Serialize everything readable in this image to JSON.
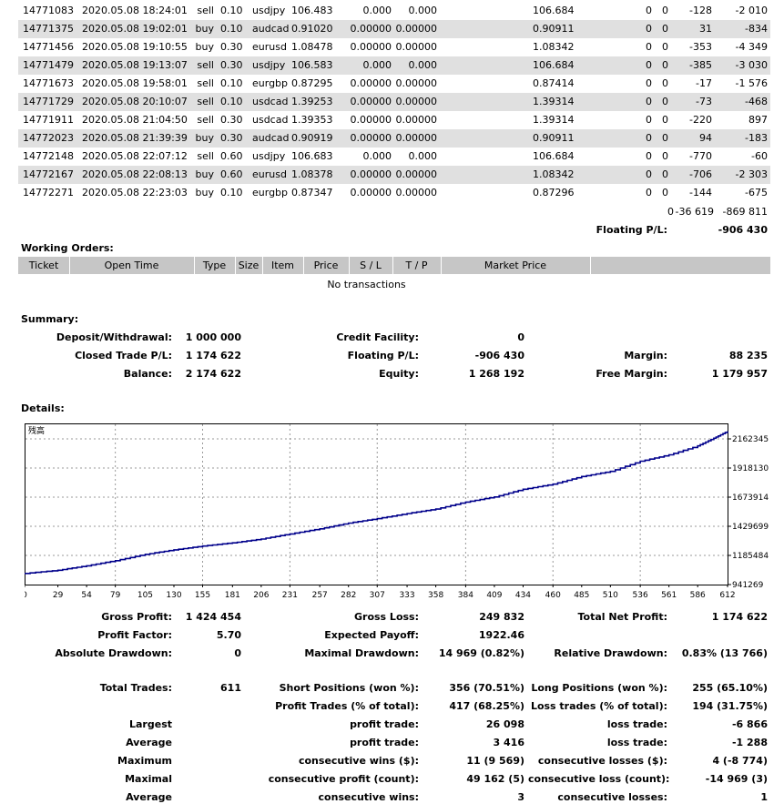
{
  "trades": [
    {
      "ticket": "14771083",
      "time": "2020.05.08 18:24:01",
      "type": "sell",
      "size": "0.10",
      "item": "usdjpy",
      "price": "106.483",
      "sl": "0.000",
      "tp": "0.000",
      "market": "106.684",
      "c1": "0",
      "c2": "0",
      "c3": "-128",
      "profit": "-2 010"
    },
    {
      "ticket": "14771375",
      "time": "2020.05.08 19:02:01",
      "type": "buy",
      "size": "0.10",
      "item": "audcad",
      "price": "0.91020",
      "sl": "0.00000",
      "tp": "0.00000",
      "market": "0.90911",
      "c1": "0",
      "c2": "0",
      "c3": "31",
      "profit": "-834"
    },
    {
      "ticket": "14771456",
      "time": "2020.05.08 19:10:55",
      "type": "buy",
      "size": "0.30",
      "item": "eurusd",
      "price": "1.08478",
      "sl": "0.00000",
      "tp": "0.00000",
      "market": "1.08342",
      "c1": "0",
      "c2": "0",
      "c3": "-353",
      "profit": "-4 349"
    },
    {
      "ticket": "14771479",
      "time": "2020.05.08 19:13:07",
      "type": "sell",
      "size": "0.30",
      "item": "usdjpy",
      "price": "106.583",
      "sl": "0.000",
      "tp": "0.000",
      "market": "106.684",
      "c1": "0",
      "c2": "0",
      "c3": "-385",
      "profit": "-3 030"
    },
    {
      "ticket": "14771673",
      "time": "2020.05.08 19:58:01",
      "type": "sell",
      "size": "0.10",
      "item": "eurgbp",
      "price": "0.87295",
      "sl": "0.00000",
      "tp": "0.00000",
      "market": "0.87414",
      "c1": "0",
      "c2": "0",
      "c3": "-17",
      "profit": "-1 576"
    },
    {
      "ticket": "14771729",
      "time": "2020.05.08 20:10:07",
      "type": "sell",
      "size": "0.10",
      "item": "usdcad",
      "price": "1.39253",
      "sl": "0.00000",
      "tp": "0.00000",
      "market": "1.39314",
      "c1": "0",
      "c2": "0",
      "c3": "-73",
      "profit": "-468"
    },
    {
      "ticket": "14771911",
      "time": "2020.05.08 21:04:50",
      "type": "sell",
      "size": "0.30",
      "item": "usdcad",
      "price": "1.39353",
      "sl": "0.00000",
      "tp": "0.00000",
      "market": "1.39314",
      "c1": "0",
      "c2": "0",
      "c3": "-220",
      "profit": "897"
    },
    {
      "ticket": "14772023",
      "time": "2020.05.08 21:39:39",
      "type": "buy",
      "size": "0.30",
      "item": "audcad",
      "price": "0.90919",
      "sl": "0.00000",
      "tp": "0.00000",
      "market": "0.90911",
      "c1": "0",
      "c2": "0",
      "c3": "94",
      "profit": "-183"
    },
    {
      "ticket": "14772148",
      "time": "2020.05.08 22:07:12",
      "type": "sell",
      "size": "0.60",
      "item": "usdjpy",
      "price": "106.683",
      "sl": "0.000",
      "tp": "0.000",
      "market": "106.684",
      "c1": "0",
      "c2": "0",
      "c3": "-770",
      "profit": "-60"
    },
    {
      "ticket": "14772167",
      "time": "2020.05.08 22:08:13",
      "type": "buy",
      "size": "0.60",
      "item": "eurusd",
      "price": "1.08378",
      "sl": "0.00000",
      "tp": "0.00000",
      "market": "1.08342",
      "c1": "0",
      "c2": "0",
      "c3": "-706",
      "profit": "-2 303"
    },
    {
      "ticket": "14772271",
      "time": "2020.05.08 22:23:03",
      "type": "buy",
      "size": "0.10",
      "item": "eurgbp",
      "price": "0.87347",
      "sl": "0.00000",
      "tp": "0.00000",
      "market": "0.87296",
      "c1": "0",
      "c2": "0",
      "c3": "-144",
      "profit": "-675"
    }
  ],
  "totals": {
    "c1": "0",
    "c2": "-36 619",
    "profit": "-869 811"
  },
  "floating": {
    "label": "Floating P/L:",
    "value": "-906 430"
  },
  "working_orders": {
    "title": "Working Orders:",
    "headers": [
      "Ticket",
      "Open Time",
      "Type",
      "Size",
      "Item",
      "Price",
      "S / L",
      "T / P",
      "Market Price"
    ],
    "empty": "No transactions"
  },
  "summary": {
    "title": "Summary:",
    "deposit_label": "Deposit/Withdrawal:",
    "deposit": "1 000 000",
    "closed_label": "Closed Trade P/L:",
    "closed": "1 174 622",
    "balance_label": "Balance:",
    "balance": "2 174 622",
    "credit_label": "Credit Facility:",
    "credit": "0",
    "floating_label": "Floating P/L:",
    "floating": "-906 430",
    "equity_label": "Equity:",
    "equity": "1 268 192",
    "margin_label": "Margin:",
    "margin": "88 235",
    "free_margin_label": "Free Margin:",
    "free_margin": "1 179 957"
  },
  "details_title": "Details:",
  "chart_data": {
    "type": "line",
    "title": "残高",
    "xlim": [
      0,
      612
    ],
    "ylim": [
      941269,
      2162345
    ],
    "x_ticks": [
      "0",
      "29",
      "54",
      "79",
      "105",
      "130",
      "155",
      "181",
      "206",
      "231",
      "257",
      "282",
      "307",
      "333",
      "358",
      "384",
      "409",
      "434",
      "460",
      "485",
      "510",
      "536",
      "561",
      "586",
      "612"
    ],
    "y_ticks": [
      "2162345",
      "1918130",
      "1673914",
      "1429699",
      "1185484",
      "941269"
    ],
    "series": [
      {
        "color": "#00008b",
        "x": [
          0,
          29,
          54,
          79,
          105,
          130,
          155,
          181,
          206,
          231,
          257,
          282,
          307,
          333,
          358,
          384,
          409,
          434,
          460,
          485,
          510,
          536,
          561,
          586,
          600,
          612
        ],
        "y": [
          1000000,
          1025000,
          1060000,
          1100000,
          1150000,
          1185000,
          1215000,
          1240000,
          1270000,
          1310000,
          1350000,
          1395000,
          1430000,
          1470000,
          1505000,
          1560000,
          1600000,
          1660000,
          1700000,
          1760000,
          1800000,
          1880000,
          1930000,
          2000000,
          2060000,
          2115000
        ]
      }
    ],
    "grid": true
  },
  "stats": {
    "gross_profit_label": "Gross Profit:",
    "gross_profit": "1 424 454",
    "gross_loss_label": "Gross Loss:",
    "gross_loss": "249 832",
    "net_profit_label": "Total Net Profit:",
    "net_profit": "1 174 622",
    "profit_factor_label": "Profit Factor:",
    "profit_factor": "5.70",
    "expected_payoff_label": "Expected Payoff:",
    "expected_payoff": "1922.46",
    "abs_dd_label": "Absolute Drawdown:",
    "abs_dd": "0",
    "max_dd_label": "Maximal Drawdown:",
    "max_dd": "14 969 (0.82%)",
    "rel_dd_label": "Relative Drawdown:",
    "rel_dd": "0.83% (13 766)",
    "total_trades_label": "Total Trades:",
    "total_trades": "611",
    "short_label": "Short Positions (won %):",
    "short": "356 (70.51%)",
    "long_label": "Long Positions (won %):",
    "long": "255 (65.10%)",
    "profit_trades_label": "Profit Trades (% of total):",
    "profit_trades": "417 (68.25%)",
    "loss_trades_label": "Loss trades (% of total):",
    "loss_trades": "194 (31.75%)",
    "largest": "Largest",
    "largest_profit_label": "profit trade:",
    "largest_profit": "26 098",
    "largest_loss_label": "loss trade:",
    "largest_loss": "-6 866",
    "average": "Average",
    "avg_profit_label": "profit trade:",
    "avg_profit": "3 416",
    "avg_loss_label": "loss trade:",
    "avg_loss": "-1 288",
    "maximum": "Maximum",
    "max_wins_label": "consecutive wins ($):",
    "max_wins": "11 (9 569)",
    "max_losses_label": "consecutive losses ($):",
    "max_losses": "4 (-8 774)",
    "maximal": "Maximal",
    "maxl_profit_label": "consecutive profit (count):",
    "maxl_profit": "49 162 (5)",
    "maxl_loss_label": "consecutive loss (count):",
    "maxl_loss": "-14 969 (3)",
    "average2": "Average",
    "avg_wins_label": "consecutive wins:",
    "avg_wins": "3",
    "avg_losses_label": "consecutive losses:",
    "avg_losses": "1"
  }
}
